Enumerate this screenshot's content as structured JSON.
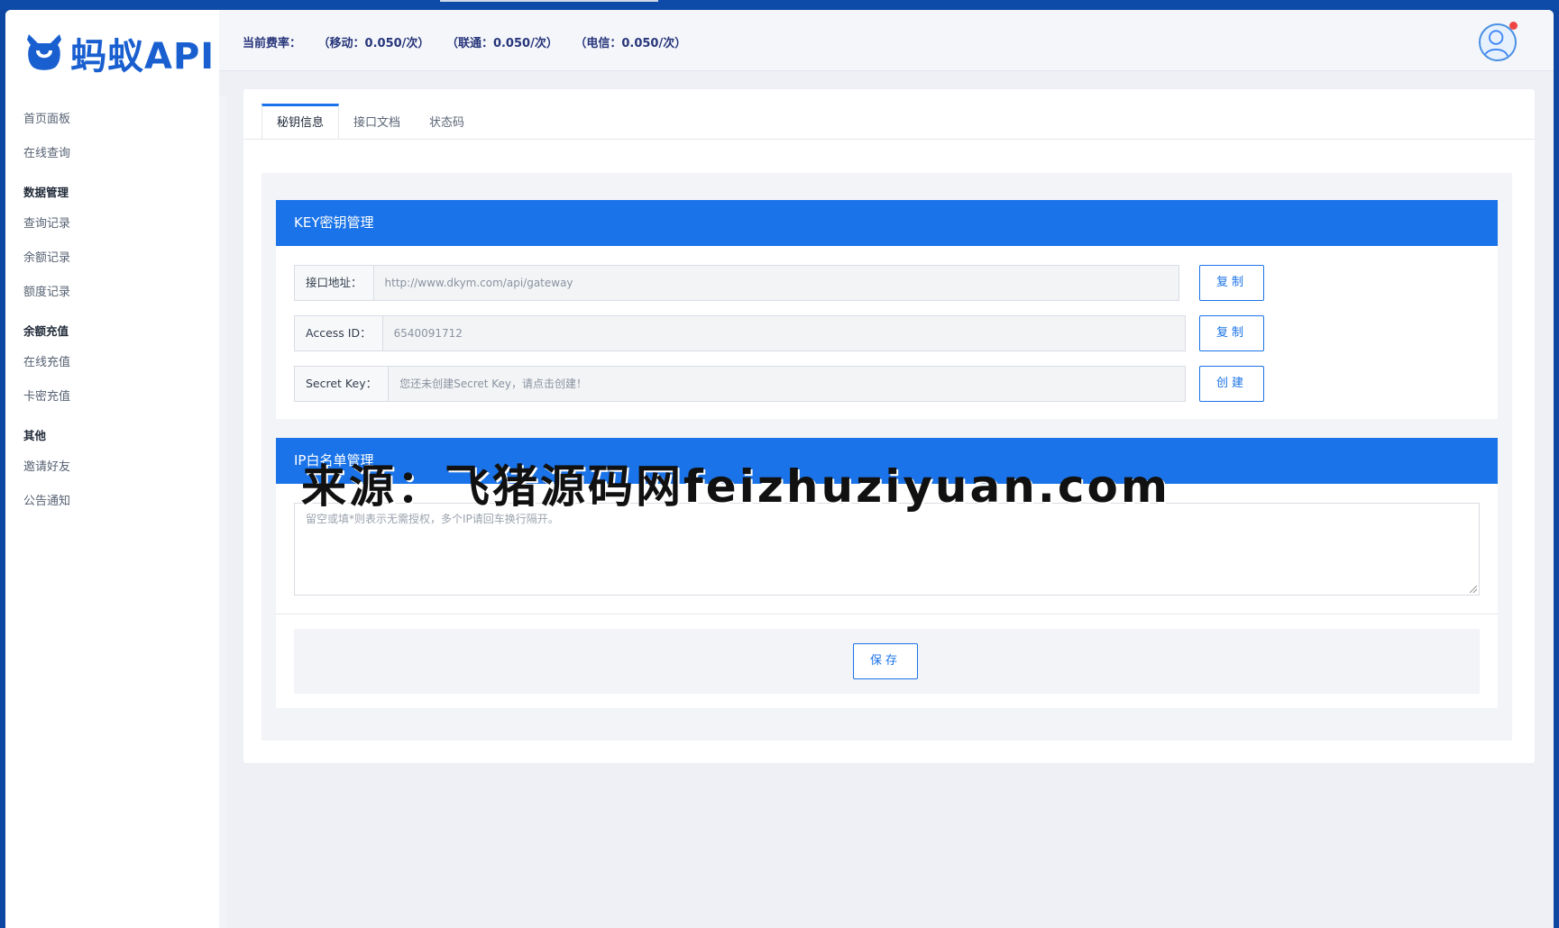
{
  "brand": {
    "logo_text": "蚂蚁API"
  },
  "sidebar": {
    "items": [
      {
        "type": "item",
        "label": "首页面板",
        "name": "sidebar-item-dashboard"
      },
      {
        "type": "item",
        "label": "在线查询",
        "name": "sidebar-item-online-query"
      },
      {
        "type": "group",
        "label": "数据管理",
        "name": "sidebar-group-data"
      },
      {
        "type": "item",
        "label": "查询记录",
        "name": "sidebar-item-query-records"
      },
      {
        "type": "item",
        "label": "余额记录",
        "name": "sidebar-item-balance-records"
      },
      {
        "type": "item",
        "label": "额度记录",
        "name": "sidebar-item-quota-records"
      },
      {
        "type": "group",
        "label": "余额充值",
        "name": "sidebar-group-recharge"
      },
      {
        "type": "item",
        "label": "在线充值",
        "name": "sidebar-item-online-recharge"
      },
      {
        "type": "item",
        "label": "卡密充值",
        "name": "sidebar-item-card-recharge"
      },
      {
        "type": "group",
        "label": "其他",
        "name": "sidebar-group-other"
      },
      {
        "type": "item",
        "label": "邀请好友",
        "name": "sidebar-item-invite"
      },
      {
        "type": "item",
        "label": "公告通知",
        "name": "sidebar-item-announcements"
      }
    ]
  },
  "header": {
    "rate_label": "当前费率：",
    "rate_mobile": "（移动：0.050/次）",
    "rate_unicom": "（联通：0.050/次）",
    "rate_telecom": "（电信：0.050/次）"
  },
  "tabs": [
    {
      "label": "秘钥信息",
      "active": true
    },
    {
      "label": "接口文档",
      "active": false
    },
    {
      "label": "状态码",
      "active": false
    }
  ],
  "key_panel": {
    "title": "KEY密钥管理",
    "api_url_label": "接口地址：",
    "api_url_value": "http://www.dkym.com/api/gateway",
    "access_id_label": "Access ID：",
    "access_id_value": "6540091712",
    "secret_key_label": "Secret Key：",
    "secret_key_placeholder": "您还未创建Secret Key，请点击创建！",
    "copy_label": "复制",
    "create_label": "创建"
  },
  "ip_panel": {
    "title": "IP白名单管理",
    "textarea_placeholder": "留空或填*则表示无需授权，多个IP请回车换行隔开。",
    "save_label": "保存"
  },
  "watermark": "来源：飞猪源码网feizhuziyuan.com",
  "colors": {
    "primary": "#1a73e8",
    "outer": "#0d47a1",
    "rate_text": "#27357a"
  }
}
